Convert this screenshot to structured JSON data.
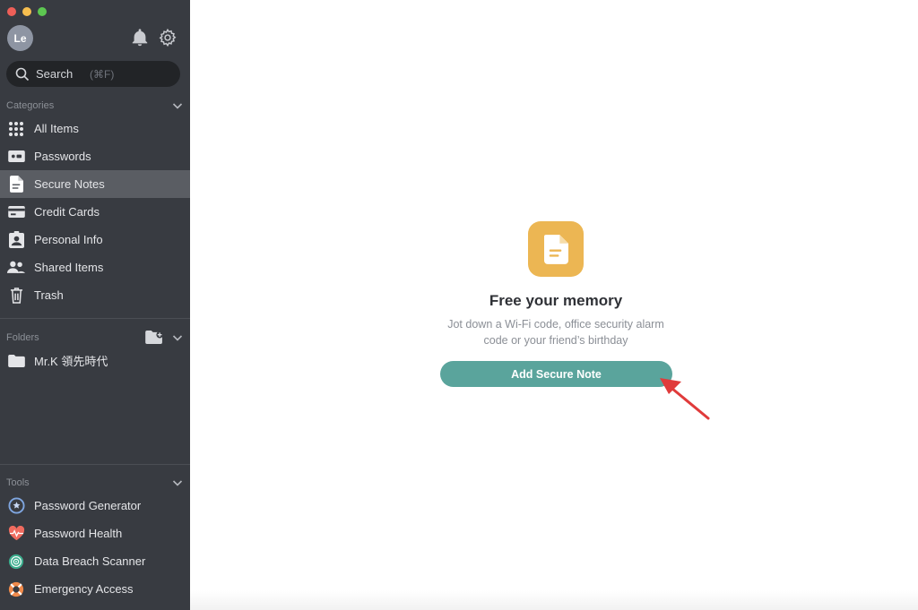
{
  "window": {
    "traffic_lights": [
      "#ee5f58",
      "#f6be4f",
      "#5dc751"
    ]
  },
  "user": {
    "initials": "Le"
  },
  "search": {
    "placeholder": "Search",
    "shortcut": "(⌘F)"
  },
  "categories": {
    "header": "Categories",
    "items": [
      {
        "label": "All Items",
        "icon": "grid-icon"
      },
      {
        "label": "Passwords",
        "icon": "password-icon"
      },
      {
        "label": "Secure Notes",
        "icon": "note-icon",
        "active": true
      },
      {
        "label": "Credit Cards",
        "icon": "credit-card-icon"
      },
      {
        "label": "Personal Info",
        "icon": "id-badge-icon"
      },
      {
        "label": "Shared Items",
        "icon": "people-icon"
      },
      {
        "label": "Trash",
        "icon": "trash-icon"
      }
    ]
  },
  "folders": {
    "header": "Folders",
    "items": [
      {
        "label": "Mr.K 領先時代",
        "icon": "folder-icon"
      }
    ]
  },
  "tools": {
    "header": "Tools",
    "items": [
      {
        "label": "Password Generator",
        "icon": "password-generator-icon"
      },
      {
        "label": "Password Health",
        "icon": "heart-pulse-icon"
      },
      {
        "label": "Data Breach Scanner",
        "icon": "radar-icon"
      },
      {
        "label": "Emergency Access",
        "icon": "lifebuoy-icon"
      }
    ]
  },
  "empty_state": {
    "icon": "document-icon",
    "title": "Free your memory",
    "description": "Jot down a Wi-Fi code, office security alarm code or your friend’s birthday",
    "button_label": "Add Secure Note"
  },
  "colors": {
    "sidebar_bg": "#383b41",
    "active_item": "#5a5d63",
    "accent_button": "#5aa49c",
    "note_icon_bg": "#ecb653",
    "annotation_arrow": "#e03b3b"
  }
}
